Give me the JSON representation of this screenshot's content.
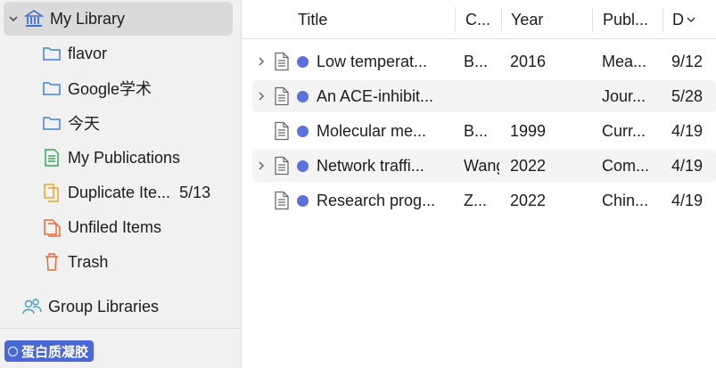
{
  "sidebar": {
    "library": {
      "label": "My Library"
    },
    "items": [
      {
        "label": "flavor",
        "icon": "folder-icon"
      },
      {
        "label": "Google学术",
        "icon": "folder-icon"
      },
      {
        "label": "今天",
        "icon": "folder-icon"
      },
      {
        "label": "My Publications",
        "icon": "publications-icon"
      },
      {
        "label": "Duplicate Ite...",
        "count": "5/13",
        "icon": "duplicate-icon"
      },
      {
        "label": "Unfiled Items",
        "icon": "unfiled-icon"
      },
      {
        "label": "Trash",
        "icon": "trash-icon"
      }
    ],
    "groups": {
      "label": "Group Libraries"
    },
    "tag": {
      "label": "蛋白质凝胶",
      "color": "#4a67d6"
    }
  },
  "table": {
    "columns": [
      "Title",
      "C...",
      "Year",
      "Publ...",
      "D"
    ],
    "dot_color": "#5b72dc",
    "rows": [
      {
        "title": "Low temperat...",
        "creator": "B...",
        "year": "2016",
        "publication": "Mea...",
        "date": "9/12",
        "expandable": true
      },
      {
        "title": "An ACE-inhibit...",
        "creator": "",
        "year": "",
        "publication": "Jour...",
        "date": "5/28",
        "expandable": true
      },
      {
        "title": "Molecular me...",
        "creator": "B...",
        "year": "1999",
        "publication": "Curr...",
        "date": "4/19",
        "expandable": false
      },
      {
        "title": "Network traffi...",
        "creator": "Wang",
        "year": "2022",
        "publication": "Com...",
        "date": "4/19",
        "expandable": true
      },
      {
        "title": "Research prog...",
        "creator": "Z...",
        "year": "2022",
        "publication": "Chin...",
        "date": "4/19",
        "expandable": false
      }
    ]
  }
}
